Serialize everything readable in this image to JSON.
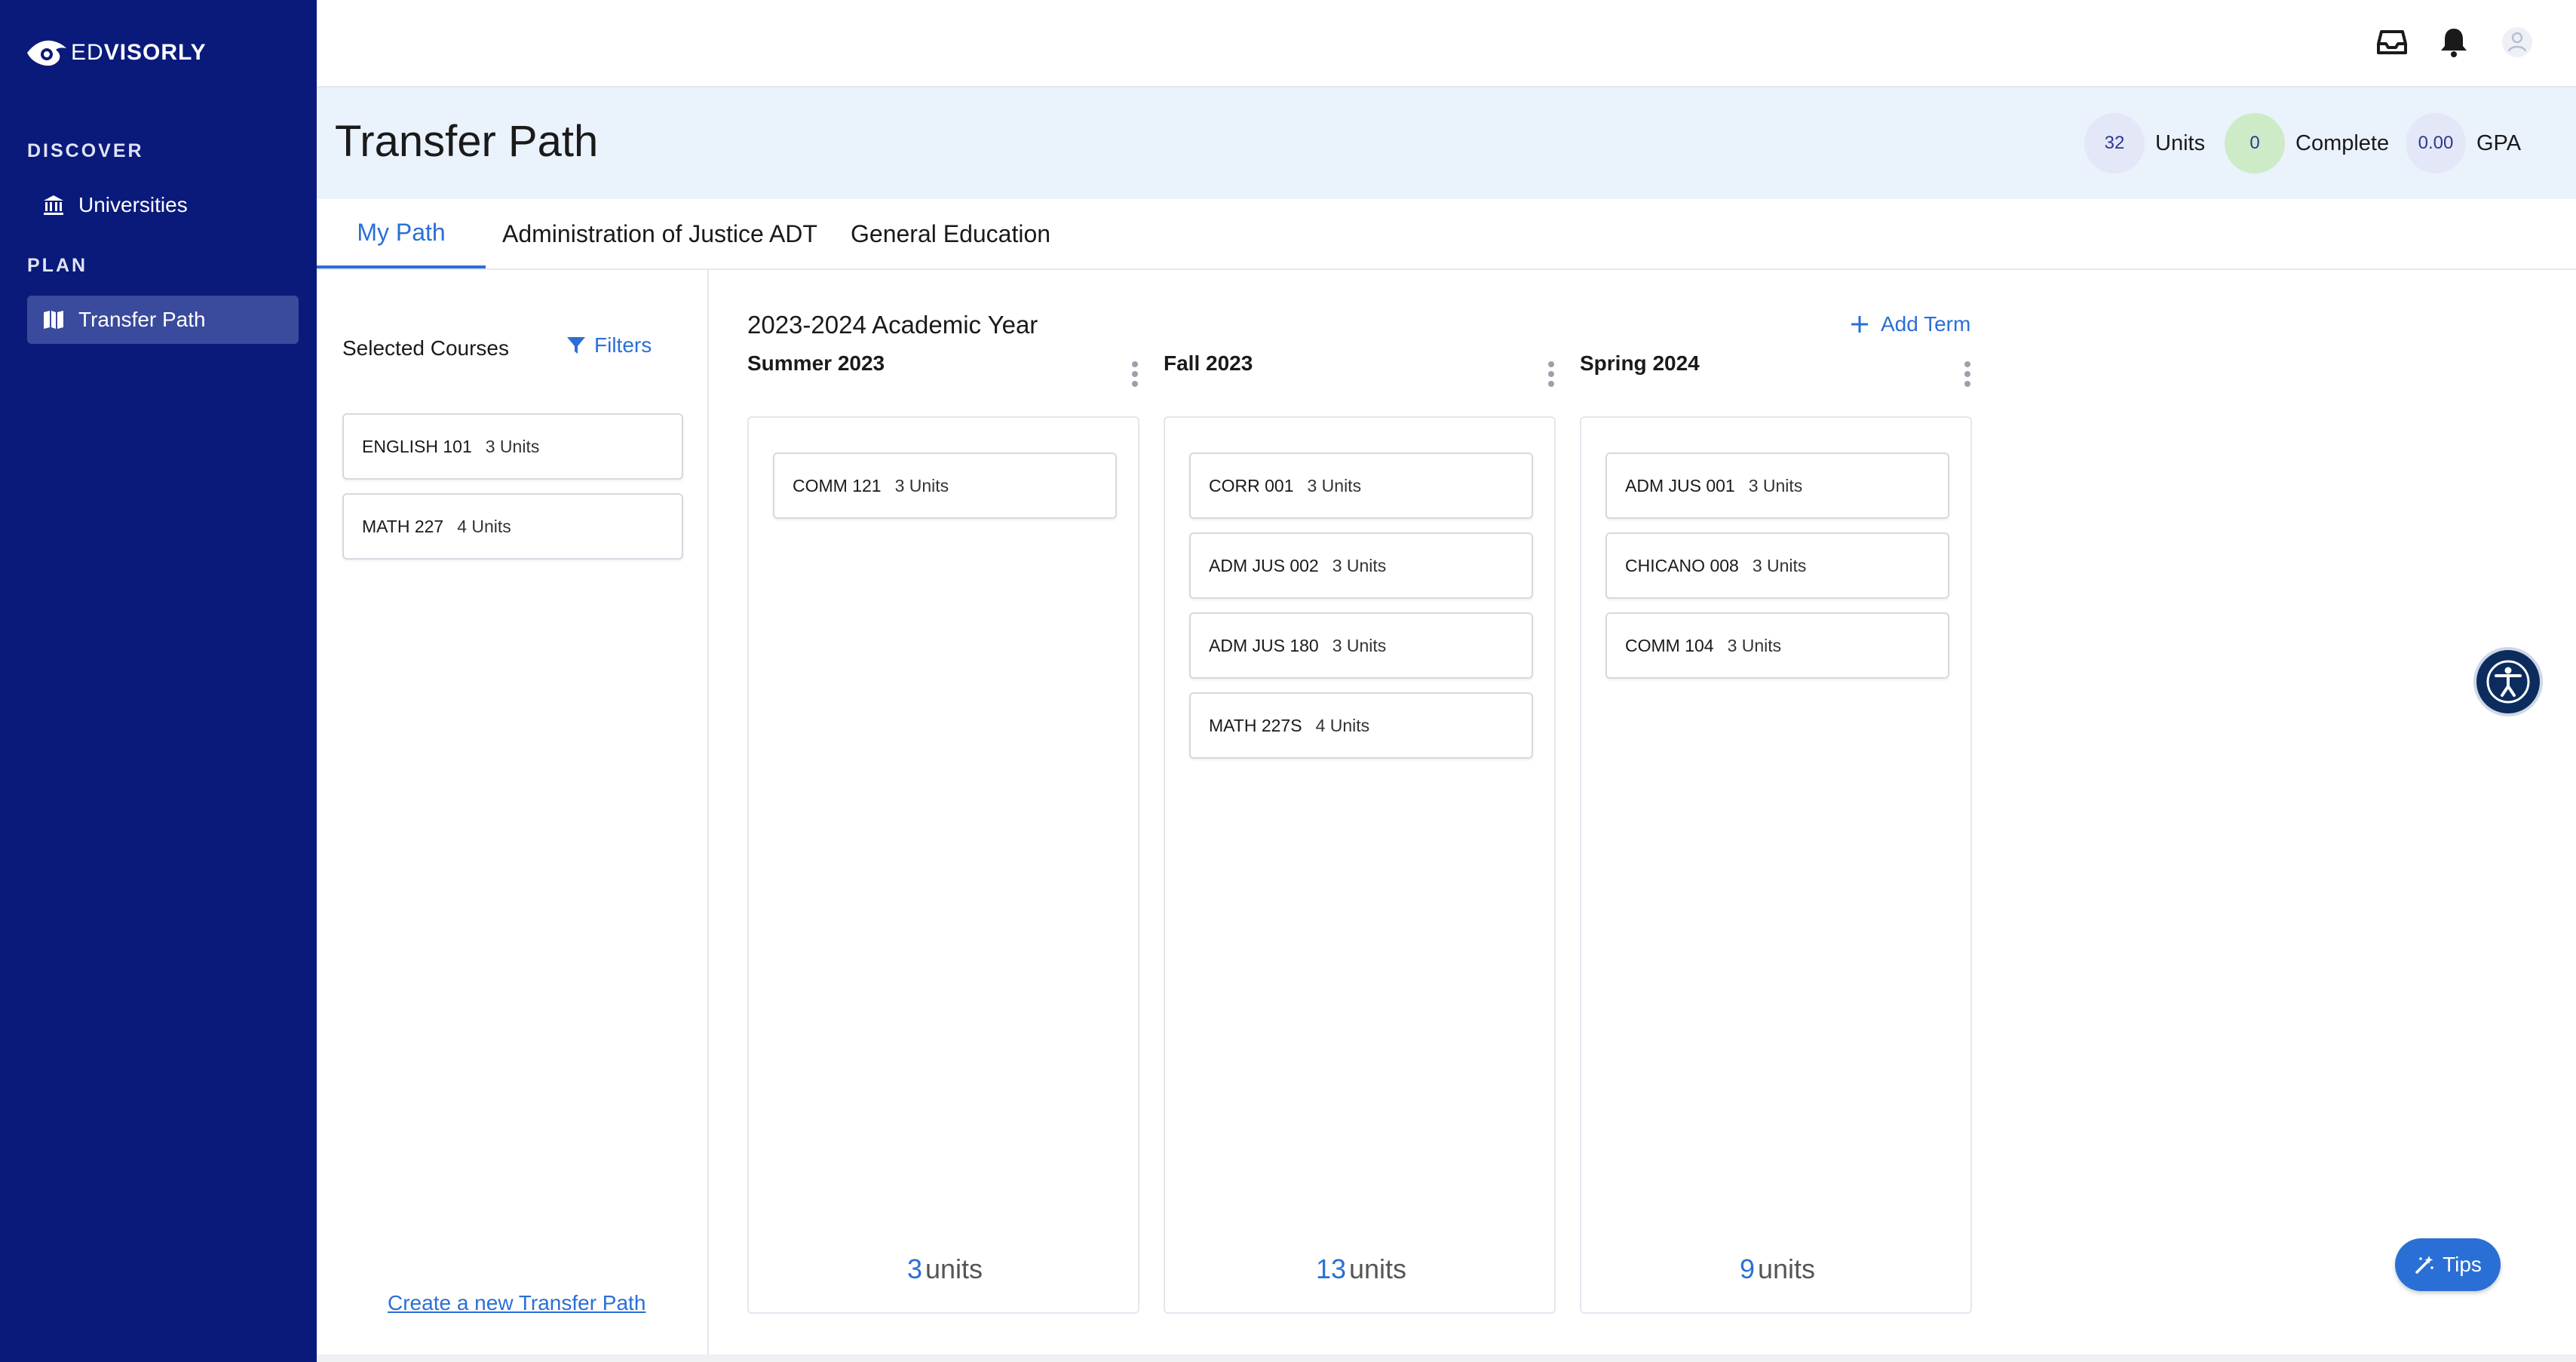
{
  "brand": {
    "logo_prefix": "ED",
    "logo_suffix": "VISORLY"
  },
  "sidebar": {
    "sections": [
      {
        "label": "DISCOVER",
        "items": [
          {
            "label": "Universities",
            "icon": "institution-icon"
          }
        ]
      },
      {
        "label": "PLAN",
        "items": [
          {
            "label": "Transfer Path",
            "icon": "map-icon",
            "active": true
          }
        ]
      }
    ]
  },
  "header": {
    "icons": [
      "inbox-icon",
      "bell-icon",
      "user-avatar-icon"
    ]
  },
  "page": {
    "title": "Transfer Path",
    "stats": [
      {
        "value": "32",
        "label": "Units",
        "color": "#e4e7f7"
      },
      {
        "value": "0",
        "label": "Complete",
        "color": "#cdebc6"
      },
      {
        "value": "0.00",
        "label": "GPA",
        "color": "#e4e7f7"
      }
    ]
  },
  "tabs": [
    {
      "label": "My Path",
      "active": true
    },
    {
      "label": "Administration of Justice ADT"
    },
    {
      "label": "General Education"
    }
  ],
  "selected_panel": {
    "heading": "Selected Courses",
    "filters_label": "Filters",
    "courses": [
      {
        "code": "ENGLISH 101",
        "units": "3 Units"
      },
      {
        "code": "MATH 227",
        "units": "4 Units"
      }
    ],
    "create_link": "Create a new Transfer Path"
  },
  "planner": {
    "year_title": "2023-2024 Academic Year",
    "add_term_label": "Add Term",
    "units_word": "units",
    "terms": [
      {
        "name": "Summer 2023",
        "total": "3",
        "courses": [
          {
            "code": "COMM 121",
            "units": "3 Units"
          }
        ]
      },
      {
        "name": "Fall 2023",
        "total": "13",
        "courses": [
          {
            "code": "CORR 001",
            "units": "3 Units"
          },
          {
            "code": "ADM JUS 002",
            "units": "3 Units"
          },
          {
            "code": "ADM JUS 180",
            "units": "3 Units"
          },
          {
            "code": "MATH 227S",
            "units": "4 Units"
          }
        ]
      },
      {
        "name": "Spring 2024",
        "total": "9",
        "courses": [
          {
            "code": "ADM JUS 001",
            "units": "3 Units"
          },
          {
            "code": "CHICANO 008",
            "units": "3 Units"
          },
          {
            "code": "COMM 104",
            "units": "3 Units"
          }
        ]
      }
    ]
  },
  "widgets": {
    "tips_label": "Tips",
    "accessibility_icon": "accessibility-icon"
  },
  "colors": {
    "sidebar": "#0a1a7a",
    "accent": "#2a6fd6",
    "title_band": "#eaf2fc"
  }
}
